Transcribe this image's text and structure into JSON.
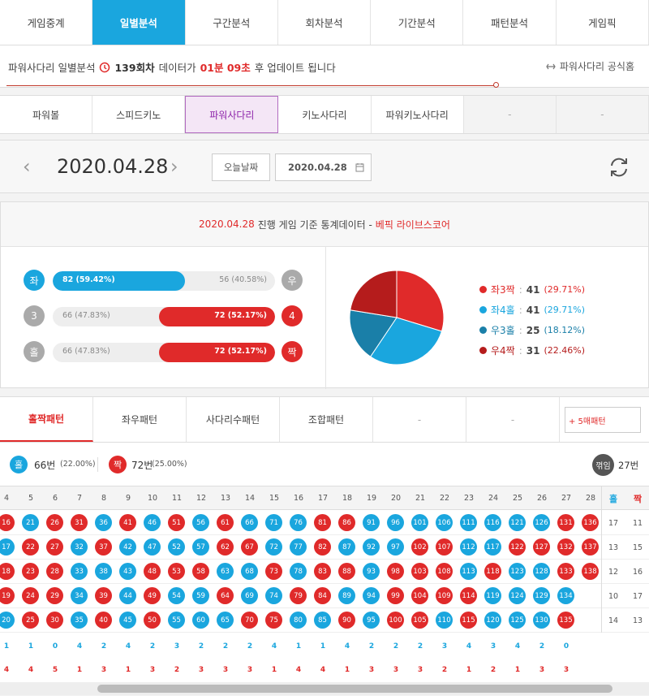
{
  "nav": {
    "tabs": [
      "게임중계",
      "일별분석",
      "구간분석",
      "회차분석",
      "기간분석",
      "패턴분석",
      "게임픽"
    ],
    "active": 1
  },
  "update": {
    "prefix": "파워사다리 일별분석",
    "round": "139회차",
    "mid": "데이터가",
    "time": "01분 09초",
    "suffix": "후 업데이트 됩니다",
    "official": "파워사다리 공식홈"
  },
  "games": {
    "tabs": [
      "파워볼",
      "스피드키노",
      "파워사다리",
      "키노사다리",
      "파워키노사다리",
      "-",
      "-"
    ],
    "active": 2
  },
  "datebar": {
    "date": "2020.04.28",
    "today": "오늘날짜",
    "picker": "2020.04.28"
  },
  "stats": {
    "head_date": "2020.04.28",
    "head_text": "진행 게임 기준 통계데이터 -",
    "head_brand": "베픽 라이브스코어",
    "rows": [
      {
        "left": "좌",
        "right": "우",
        "lv": "82 (59.42%)",
        "rv": "56 (40.58%)",
        "pct": 0.5942,
        "side": "left",
        "lc": "#1aa6de",
        "rc": "#aaa"
      },
      {
        "left": "3",
        "right": "4",
        "lv": "66 (47.83%)",
        "rv": "72 (52.17%)",
        "pct": 0.5217,
        "side": "right",
        "lc": "#aaa",
        "rc": "#e02a2a"
      },
      {
        "left": "홀",
        "right": "짝",
        "lv": "66 (47.83%)",
        "rv": "72 (52.17%)",
        "pct": 0.5217,
        "side": "right",
        "lc": "#aaa",
        "rc": "#e02a2a"
      }
    ],
    "legend": [
      {
        "name": "좌3짝",
        "val": "41",
        "pct": "(29.71%)",
        "color": "#e02a2a"
      },
      {
        "name": "좌4홀",
        "val": "41",
        "pct": "(29.71%)",
        "color": "#1aa6de"
      },
      {
        "name": "우3홀",
        "val": "25",
        "pct": "(18.12%)",
        "color": "#1a7fa8"
      },
      {
        "name": "우4짝",
        "val": "31",
        "pct": "(22.46%)",
        "color": "#b51c1c"
      }
    ]
  },
  "chart_data": {
    "type": "pie",
    "categories": [
      "좌3짝",
      "좌4홀",
      "우3홀",
      "우4짝"
    ],
    "values": [
      41,
      41,
      25,
      31
    ],
    "colors": [
      "#e02a2a",
      "#1aa6de",
      "#1a7fa8",
      "#b51c1c"
    ]
  },
  "pattern": {
    "tabs": [
      "홀짝패턴",
      "좌우패턴",
      "사다리수패턴",
      "조합패턴",
      "-",
      "-"
    ],
    "active": 0,
    "five": "+ 5매패턴",
    "odd_label": "홀",
    "odd_val": "66번",
    "odd_pct": "(22.00%)",
    "even_label": "짝",
    "even_val": "72번",
    "even_pct": "(25.00%)",
    "turn_label": "꺾임",
    "turn_val": "27번",
    "col_headers": [
      "4",
      "5",
      "6",
      "7",
      "8",
      "9",
      "10",
      "11",
      "12",
      "13",
      "14",
      "15",
      "16",
      "17",
      "18",
      "19",
      "20",
      "21",
      "22",
      "23",
      "24",
      "25",
      "26",
      "27",
      "28"
    ],
    "side_headers": [
      "홀",
      "짝"
    ],
    "columns": [
      {
        "n": [
          16,
          17,
          18,
          19,
          20
        ],
        "c": "r"
      },
      {
        "n": [
          21,
          22,
          23,
          24,
          25
        ],
        "c": "x"
      },
      {
        "n": [
          26,
          27,
          28,
          29,
          30
        ],
        "c": "r"
      },
      {
        "n": [
          31,
          32,
          33,
          34,
          35
        ],
        "c": "x"
      },
      {
        "n": [
          36,
          37,
          38,
          39,
          40
        ],
        "c": "x"
      },
      {
        "n": [
          41,
          42,
          43,
          44,
          45
        ],
        "c": "x"
      },
      {
        "n": [
          46,
          47,
          48,
          49,
          50
        ],
        "c": "x"
      },
      {
        "n": [
          51,
          52,
          53,
          54,
          55
        ],
        "c": "x"
      },
      {
        "n": [
          56,
          57,
          58,
          59,
          60
        ],
        "c": "x"
      },
      {
        "n": [
          61,
          62,
          63,
          64,
          65
        ],
        "c": "x"
      },
      {
        "n": [
          66,
          67,
          68,
          69,
          70
        ],
        "c": "x"
      },
      {
        "n": [
          71,
          72,
          73,
          74,
          75
        ],
        "c": "x"
      },
      {
        "n": [
          76,
          77,
          78,
          79,
          80
        ],
        "c": "x"
      },
      {
        "n": [
          81,
          82,
          83,
          84,
          85
        ],
        "c": "x"
      },
      {
        "n": [
          86,
          87,
          88,
          89,
          90
        ],
        "c": "x"
      },
      {
        "n": [
          91,
          92,
          93,
          94,
          95
        ],
        "c": "x"
      },
      {
        "n": [
          96,
          97,
          98,
          99,
          100
        ],
        "c": "x"
      },
      {
        "n": [
          101,
          102,
          103,
          104,
          105
        ],
        "c": "x"
      },
      {
        "n": [
          106,
          107,
          108,
          109,
          110
        ],
        "c": "x"
      },
      {
        "n": [
          111,
          112,
          113,
          114,
          115
        ],
        "c": "x"
      },
      {
        "n": [
          116,
          117,
          118,
          119,
          120
        ],
        "c": "x"
      },
      {
        "n": [
          121,
          122,
          123,
          124,
          125
        ],
        "c": "x"
      },
      {
        "n": [
          126,
          127,
          128,
          129,
          130
        ],
        "c": "x"
      },
      {
        "n": [
          131,
          132,
          133,
          134,
          135
        ],
        "c": "x"
      },
      {
        "n": [
          136,
          137,
          138
        ],
        "c": "x"
      }
    ],
    "colors": [
      [
        "r",
        "b",
        "r",
        "r",
        "b"
      ],
      [
        "b",
        "r",
        "r",
        "r",
        "r"
      ],
      [
        "r",
        "r",
        "r",
        "r",
        "r"
      ],
      [
        "r",
        "b",
        "b",
        "b",
        "b"
      ],
      [
        "b",
        "r",
        "b",
        "r",
        "r"
      ],
      [
        "r",
        "b",
        "b",
        "b",
        "b"
      ],
      [
        "b",
        "b",
        "r",
        "r",
        "r"
      ],
      [
        "r",
        "b",
        "r",
        "b",
        "b"
      ],
      [
        "b",
        "b",
        "r",
        "b",
        "b"
      ],
      [
        "r",
        "r",
        "b",
        "r",
        "b"
      ],
      [
        "b",
        "r",
        "b",
        "b",
        "r"
      ],
      [
        "b",
        "b",
        "r",
        "b",
        "r"
      ],
      [
        "b",
        "b",
        "b",
        "r",
        "b"
      ],
      [
        "r",
        "r",
        "r",
        "r",
        "b"
      ],
      [
        "r",
        "b",
        "r",
        "b",
        "r"
      ],
      [
        "b",
        "b",
        "b",
        "b",
        "b"
      ],
      [
        "b",
        "b",
        "r",
        "r",
        "r"
      ],
      [
        "b",
        "r",
        "r",
        "r",
        "r"
      ],
      [
        "b",
        "r",
        "r",
        "r",
        "b"
      ],
      [
        "b",
        "b",
        "b",
        "r",
        "r"
      ],
      [
        "b",
        "b",
        "r",
        "b",
        "b"
      ],
      [
        "b",
        "r",
        "b",
        "b",
        "b"
      ],
      [
        "b",
        "r",
        "b",
        "b",
        "b"
      ],
      [
        "r",
        "r",
        "r",
        "b",
        "r"
      ],
      [
        "r",
        "r",
        "r"
      ]
    ],
    "side_counts": [
      [
        "17",
        "11"
      ],
      [
        "13",
        "15"
      ],
      [
        "12",
        "16"
      ],
      [
        "10",
        "17"
      ],
      [
        "14",
        "13"
      ]
    ],
    "odd_counts": [
      "1",
      "1",
      "0",
      "4",
      "2",
      "4",
      "2",
      "3",
      "2",
      "2",
      "2",
      "4",
      "1",
      "1",
      "4",
      "2",
      "2",
      "2",
      "3",
      "4",
      "3",
      "4",
      "2",
      "0"
    ],
    "even_counts": [
      "4",
      "4",
      "5",
      "1",
      "3",
      "1",
      "3",
      "2",
      "3",
      "3",
      "3",
      "1",
      "4",
      "4",
      "1",
      "3",
      "3",
      "3",
      "2",
      "1",
      "2",
      "1",
      "3",
      "3"
    ]
  }
}
